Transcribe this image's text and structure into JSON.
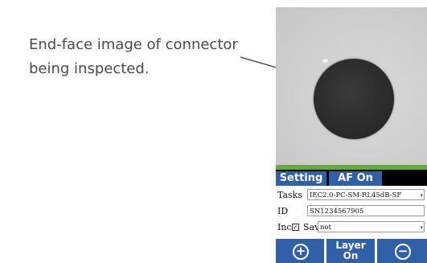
{
  "caption": {
    "line1": "End-face image of connector",
    "line2": "being inspected."
  },
  "device": {
    "tabs": {
      "setting": "Setting",
      "af": "AF On"
    },
    "form": {
      "tasks_label": "Tasks",
      "tasks_value": "IEC2.0-PC-SM-RL45dB-SF",
      "id_label": "ID",
      "id_value": "SN1234567905",
      "inc_label": "Inc",
      "inc_checked": true,
      "check_mark": "✓",
      "save_label": "Save",
      "save_value": "not",
      "dropdown_caret": "▾"
    },
    "buttons": {
      "zoom_in_icon": "+",
      "layer_line1": "Layer",
      "layer_line2": "On",
      "zoom_out_icon": "−"
    }
  },
  "colors": {
    "tab_blue": "#2f60a8",
    "status_green": "#5fae3c",
    "fiber_core": "#2b2b2b",
    "scope_background": "#cfcfcf"
  }
}
